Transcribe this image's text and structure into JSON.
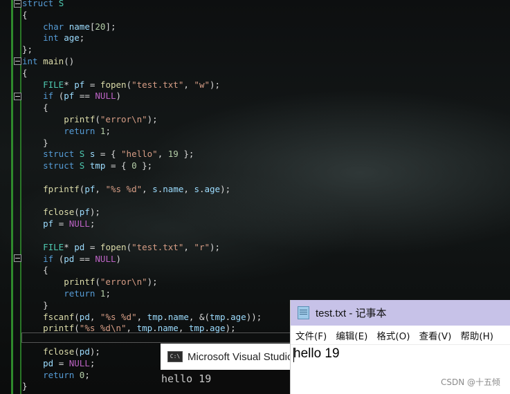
{
  "editor": {
    "lines": [
      [
        [
          "kw",
          "struct"
        ],
        [
          "pl",
          " "
        ],
        [
          "ty",
          "S"
        ]
      ],
      [
        [
          "pl",
          "{"
        ]
      ],
      [
        [
          "pl",
          "    "
        ],
        [
          "kw",
          "char"
        ],
        [
          "pl",
          " "
        ],
        [
          "vr",
          "name"
        ],
        [
          "pl",
          "["
        ],
        [
          "nm",
          "20"
        ],
        [
          "pl",
          "];"
        ]
      ],
      [
        [
          "pl",
          "    "
        ],
        [
          "kw",
          "int"
        ],
        [
          "pl",
          " "
        ],
        [
          "vr",
          "age"
        ],
        [
          "pl",
          ";"
        ]
      ],
      [
        [
          "pl",
          "};"
        ]
      ],
      [
        [
          "kw",
          "int"
        ],
        [
          "pl",
          " "
        ],
        [
          "fn",
          "main"
        ],
        [
          "pl",
          "()"
        ]
      ],
      [
        [
          "pl",
          "{"
        ]
      ],
      [
        [
          "pl",
          "    "
        ],
        [
          "ty",
          "FILE"
        ],
        [
          "pl",
          "* "
        ],
        [
          "vr",
          "pf"
        ],
        [
          "pl",
          " = "
        ],
        [
          "fn",
          "fopen"
        ],
        [
          "pl",
          "("
        ],
        [
          "st",
          "\"test.txt\""
        ],
        [
          "pl",
          ", "
        ],
        [
          "st",
          "\"w\""
        ],
        [
          "pl",
          ");"
        ]
      ],
      [
        [
          "pl",
          "    "
        ],
        [
          "kw",
          "if"
        ],
        [
          "pl",
          " ("
        ],
        [
          "vr",
          "pf"
        ],
        [
          "pl",
          " == "
        ],
        [
          "mc",
          "NULL"
        ],
        [
          "pl",
          ")"
        ]
      ],
      [
        [
          "pl",
          "    {"
        ]
      ],
      [
        [
          "pl",
          "        "
        ],
        [
          "fn",
          "printf"
        ],
        [
          "pl",
          "("
        ],
        [
          "st",
          "\"error\\n\""
        ],
        [
          "pl",
          ");"
        ]
      ],
      [
        [
          "pl",
          "        "
        ],
        [
          "kw",
          "return"
        ],
        [
          "pl",
          " "
        ],
        [
          "nm",
          "1"
        ],
        [
          "pl",
          ";"
        ]
      ],
      [
        [
          "pl",
          "    }"
        ]
      ],
      [
        [
          "pl",
          "    "
        ],
        [
          "kw",
          "struct"
        ],
        [
          "pl",
          " "
        ],
        [
          "ty",
          "S"
        ],
        [
          "pl",
          " "
        ],
        [
          "vr",
          "s"
        ],
        [
          "pl",
          " = { "
        ],
        [
          "st",
          "\"hello\""
        ],
        [
          "pl",
          ", "
        ],
        [
          "nm",
          "19"
        ],
        [
          "pl",
          " };"
        ]
      ],
      [
        [
          "pl",
          "    "
        ],
        [
          "kw",
          "struct"
        ],
        [
          "pl",
          " "
        ],
        [
          "ty",
          "S"
        ],
        [
          "pl",
          " "
        ],
        [
          "vr",
          "tmp"
        ],
        [
          "pl",
          " = { "
        ],
        [
          "nm",
          "0"
        ],
        [
          "pl",
          " };"
        ]
      ],
      [
        [
          "pl",
          ""
        ]
      ],
      [
        [
          "pl",
          "    "
        ],
        [
          "fn",
          "fprintf"
        ],
        [
          "pl",
          "("
        ],
        [
          "vr",
          "pf"
        ],
        [
          "pl",
          ", "
        ],
        [
          "st",
          "\"%s %d\""
        ],
        [
          "pl",
          ", "
        ],
        [
          "vr",
          "s"
        ],
        [
          "pl",
          "."
        ],
        [
          "vr",
          "name"
        ],
        [
          "pl",
          ", "
        ],
        [
          "vr",
          "s"
        ],
        [
          "pl",
          "."
        ],
        [
          "vr",
          "age"
        ],
        [
          "pl",
          ");"
        ]
      ],
      [
        [
          "pl",
          ""
        ]
      ],
      [
        [
          "pl",
          "    "
        ],
        [
          "fn",
          "fclose"
        ],
        [
          "pl",
          "("
        ],
        [
          "vr",
          "pf"
        ],
        [
          "pl",
          ");"
        ]
      ],
      [
        [
          "pl",
          "    "
        ],
        [
          "vr",
          "pf"
        ],
        [
          "pl",
          " = "
        ],
        [
          "mc",
          "NULL"
        ],
        [
          "pl",
          ";"
        ]
      ],
      [
        [
          "pl",
          ""
        ]
      ],
      [
        [
          "pl",
          "    "
        ],
        [
          "ty",
          "FILE"
        ],
        [
          "pl",
          "* "
        ],
        [
          "vr",
          "pd"
        ],
        [
          "pl",
          " = "
        ],
        [
          "fn",
          "fopen"
        ],
        [
          "pl",
          "("
        ],
        [
          "st",
          "\"test.txt\""
        ],
        [
          "pl",
          ", "
        ],
        [
          "st",
          "\"r\""
        ],
        [
          "pl",
          ");"
        ]
      ],
      [
        [
          "pl",
          "    "
        ],
        [
          "kw",
          "if"
        ],
        [
          "pl",
          " ("
        ],
        [
          "vr",
          "pd"
        ],
        [
          "pl",
          " == "
        ],
        [
          "mc",
          "NULL"
        ],
        [
          "pl",
          ")"
        ]
      ],
      [
        [
          "pl",
          "    {"
        ]
      ],
      [
        [
          "pl",
          "        "
        ],
        [
          "fn",
          "printf"
        ],
        [
          "pl",
          "("
        ],
        [
          "st",
          "\"error\\n\""
        ],
        [
          "pl",
          ");"
        ]
      ],
      [
        [
          "pl",
          "        "
        ],
        [
          "kw",
          "return"
        ],
        [
          "pl",
          " "
        ],
        [
          "nm",
          "1"
        ],
        [
          "pl",
          ";"
        ]
      ],
      [
        [
          "pl",
          "    }"
        ]
      ],
      [
        [
          "pl",
          "    "
        ],
        [
          "fn",
          "fscanf"
        ],
        [
          "pl",
          "("
        ],
        [
          "vr",
          "pd"
        ],
        [
          "pl",
          ", "
        ],
        [
          "st",
          "\"%s %d\""
        ],
        [
          "pl",
          ", "
        ],
        [
          "vr",
          "tmp"
        ],
        [
          "pl",
          "."
        ],
        [
          "vr",
          "name"
        ],
        [
          "pl",
          ", &("
        ],
        [
          "vr",
          "tmp"
        ],
        [
          "pl",
          "."
        ],
        [
          "vr",
          "age"
        ],
        [
          "pl",
          "));"
        ]
      ],
      [
        [
          "pl",
          "    "
        ],
        [
          "fn",
          "printf"
        ],
        [
          "pl",
          "("
        ],
        [
          "st",
          "\"%s %d\\n\""
        ],
        [
          "pl",
          ", "
        ],
        [
          "vr",
          "tmp"
        ],
        [
          "pl",
          "."
        ],
        [
          "vr",
          "name"
        ],
        [
          "pl",
          ", "
        ],
        [
          "vr",
          "tmp"
        ],
        [
          "pl",
          "."
        ],
        [
          "vr",
          "age"
        ],
        [
          "pl",
          ");"
        ]
      ],
      [
        [
          "pl",
          ""
        ]
      ],
      [
        [
          "pl",
          "    "
        ],
        [
          "fn",
          "fclose"
        ],
        [
          "pl",
          "("
        ],
        [
          "vr",
          "pd"
        ],
        [
          "pl",
          ");"
        ]
      ],
      [
        [
          "pl",
          "    "
        ],
        [
          "vr",
          "pd"
        ],
        [
          "pl",
          " = "
        ],
        [
          "mc",
          "NULL"
        ],
        [
          "pl",
          ";"
        ]
      ],
      [
        [
          "pl",
          "    "
        ],
        [
          "kw",
          "return"
        ],
        [
          "pl",
          " "
        ],
        [
          "nm",
          "0"
        ],
        [
          "pl",
          ";"
        ]
      ],
      [
        [
          "pl",
          "}"
        ]
      ]
    ]
  },
  "console": {
    "icon_text": "C:\\",
    "title": "Microsoft Visual Studio",
    "output": "hello 19"
  },
  "notepad": {
    "title": "test.txt - 记事本",
    "menu": [
      "文件(F)",
      "编辑(E)",
      "格式(O)",
      "查看(V)",
      "帮助(H)"
    ],
    "content": "hello 19"
  },
  "watermark": "CSDN @十五倾"
}
